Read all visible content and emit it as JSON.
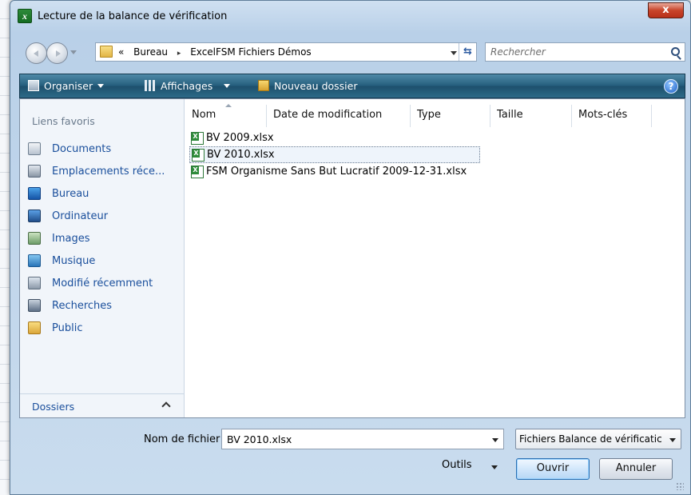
{
  "window": {
    "title": "Lecture de la balance de vérification",
    "close_label": "x"
  },
  "address": {
    "overflow": "«",
    "crumbs": [
      "Bureau",
      "ExcelFSM Fichiers Démos"
    ],
    "separator": "▸"
  },
  "search": {
    "placeholder": "Rechercher"
  },
  "toolbar": {
    "organise_label": "Organiser",
    "views_label": "Affichages",
    "new_folder_label": "Nouveau dossier",
    "help_label": "?"
  },
  "sidebar": {
    "heading": "Liens favoris",
    "items": [
      {
        "label": "Documents",
        "icon": "documents-icon"
      },
      {
        "label": "Emplacements réce...",
        "icon": "recent-places-icon"
      },
      {
        "label": "Bureau",
        "icon": "desktop-icon"
      },
      {
        "label": "Ordinateur",
        "icon": "computer-icon"
      },
      {
        "label": "Images",
        "icon": "pictures-icon"
      },
      {
        "label": "Musique",
        "icon": "music-icon"
      },
      {
        "label": "Modifié récemment",
        "icon": "recently-changed-icon"
      },
      {
        "label": "Recherches",
        "icon": "searches-icon"
      },
      {
        "label": "Public",
        "icon": "public-folder-icon"
      }
    ],
    "folders_label": "Dossiers"
  },
  "columns": [
    "Nom",
    "Date de modification",
    "Type",
    "Taille",
    "Mots-clés"
  ],
  "files": [
    {
      "name": "BV 2009.xlsx",
      "selected": false
    },
    {
      "name": "BV 2010.xlsx",
      "selected": true
    },
    {
      "name": "FSM Organisme Sans But Lucratif 2009-12-31.xlsx",
      "selected": false
    }
  ],
  "footer": {
    "filename_label": "Nom de fichier :",
    "filename_value": "BV 2010.xlsx",
    "filetype_value": "Fichiers Balance de vérificatic",
    "tools_label": "Outils",
    "open_label": "Ouvrir",
    "cancel_label": "Annuler"
  },
  "colors": {
    "toolbar": "#245d7c",
    "link": "#1a4f9c",
    "close": "#c8442a"
  }
}
